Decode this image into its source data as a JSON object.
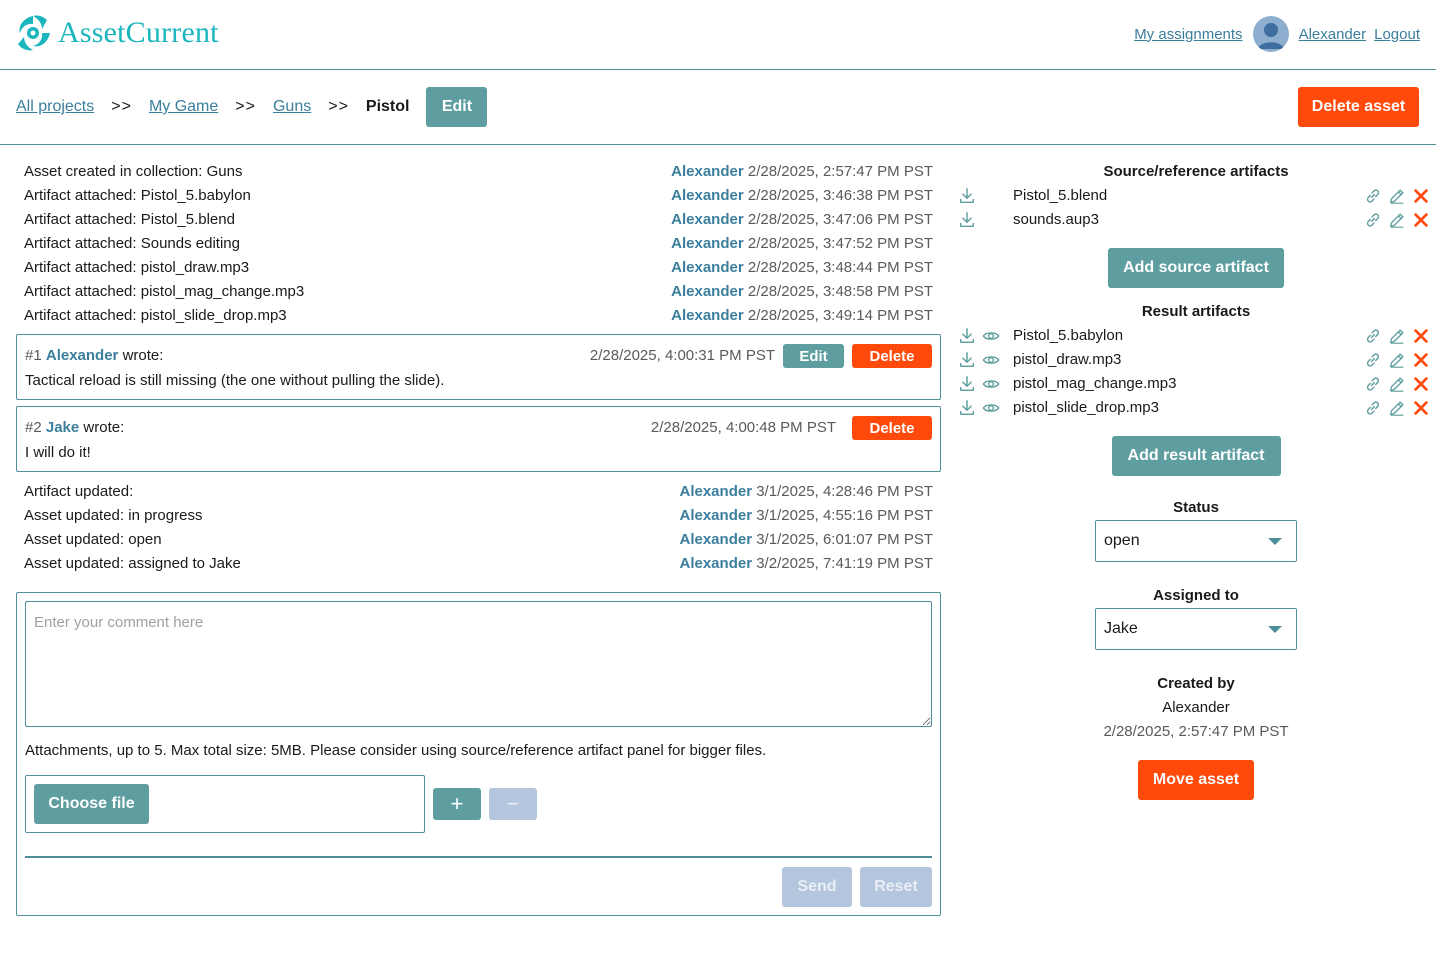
{
  "app": {
    "name": "AssetCurrent"
  },
  "header": {
    "assignments_link": "My assignments",
    "user_link": "Alexander",
    "logout_link": "Logout"
  },
  "breadcrumb": {
    "items": [
      "All projects",
      "My Game",
      "Guns"
    ],
    "separator": ">>",
    "current": "Pistol",
    "edit_label": "Edit"
  },
  "delete_asset_label": "Delete asset",
  "events_top": [
    {
      "text": "Asset created in collection: Guns",
      "user": "Alexander",
      "time": "2/28/2025, 2:57:47 PM PST"
    },
    {
      "text": "Artifact attached: Pistol_5.babylon",
      "user": "Alexander",
      "time": "2/28/2025, 3:46:38 PM PST"
    },
    {
      "text": "Artifact attached: Pistol_5.blend",
      "user": "Alexander",
      "time": "2/28/2025, 3:47:06 PM PST"
    },
    {
      "text": "Artifact attached: Sounds editing",
      "user": "Alexander",
      "time": "2/28/2025, 3:47:52 PM PST"
    },
    {
      "text": "Artifact attached: pistol_draw.mp3",
      "user": "Alexander",
      "time": "2/28/2025, 3:48:44 PM PST"
    },
    {
      "text": "Artifact attached: pistol_mag_change.mp3",
      "user": "Alexander",
      "time": "2/28/2025, 3:48:58 PM PST"
    },
    {
      "text": "Artifact attached: pistol_slide_drop.mp3",
      "user": "Alexander",
      "time": "2/28/2025, 3:49:14 PM PST"
    }
  ],
  "comments": [
    {
      "number": "#1",
      "user": "Alexander",
      "wrote": "wrote:",
      "time": "2/28/2025, 4:00:31 PM PST",
      "edit_label": "Edit",
      "delete_label": "Delete",
      "body": "Tactical reload is still missing (the one without pulling the slide)."
    },
    {
      "number": "#2",
      "user": "Jake",
      "wrote": "wrote:",
      "time": "2/28/2025, 4:00:48 PM PST",
      "delete_label": "Delete",
      "body": "I will do it!"
    }
  ],
  "events_bottom": [
    {
      "text": "Artifact updated:",
      "user": "Alexander",
      "time": "3/1/2025, 4:28:46 PM PST"
    },
    {
      "text": "Asset updated: in progress",
      "user": "Alexander",
      "time": "3/1/2025, 4:55:16 PM PST"
    },
    {
      "text": "Asset updated: open",
      "user": "Alexander",
      "time": "3/1/2025, 6:01:07 PM PST"
    },
    {
      "text": "Asset updated: assigned to Jake",
      "user": "Alexander",
      "time": "3/2/2025, 7:41:19 PM PST"
    }
  ],
  "composer": {
    "placeholder": "Enter your comment here",
    "attachments_note": "Attachments, up to 5. Max total size: 5MB. Please consider using source/reference artifact panel for bigger files.",
    "choose_file_label": "Choose file",
    "add_label": "+",
    "remove_label": "−",
    "send_label": "Send",
    "reset_label": "Reset"
  },
  "source_artifacts": {
    "title": "Source/reference artifacts",
    "items": [
      "Pistol_5.blend",
      "sounds.aup3"
    ],
    "add_label": "Add source artifact"
  },
  "result_artifacts": {
    "title": "Result artifacts",
    "items": [
      "Pistol_5.babylon",
      "pistol_draw.mp3",
      "pistol_mag_change.mp3",
      "pistol_slide_drop.mp3"
    ],
    "add_label": "Add result artifact"
  },
  "status": {
    "label": "Status",
    "value": "open"
  },
  "assigned": {
    "label": "Assigned to",
    "value": "Jake"
  },
  "created": {
    "label": "Created by",
    "user": "Alexander",
    "time": "2/28/2025, 2:57:47 PM PST"
  },
  "move_asset_label": "Move asset",
  "colors": {
    "teal": "#5e9ea0",
    "red": "#ff4a0b",
    "link": "#3b7f9c",
    "logo": "#1bb5bd",
    "disabled": "#b4c6dd"
  },
  "icons": [
    "logo-swirl-icon",
    "avatar-icon",
    "download-icon",
    "eye-icon",
    "link-icon",
    "pencil-icon",
    "close-icon",
    "chevron-down-icon"
  ]
}
